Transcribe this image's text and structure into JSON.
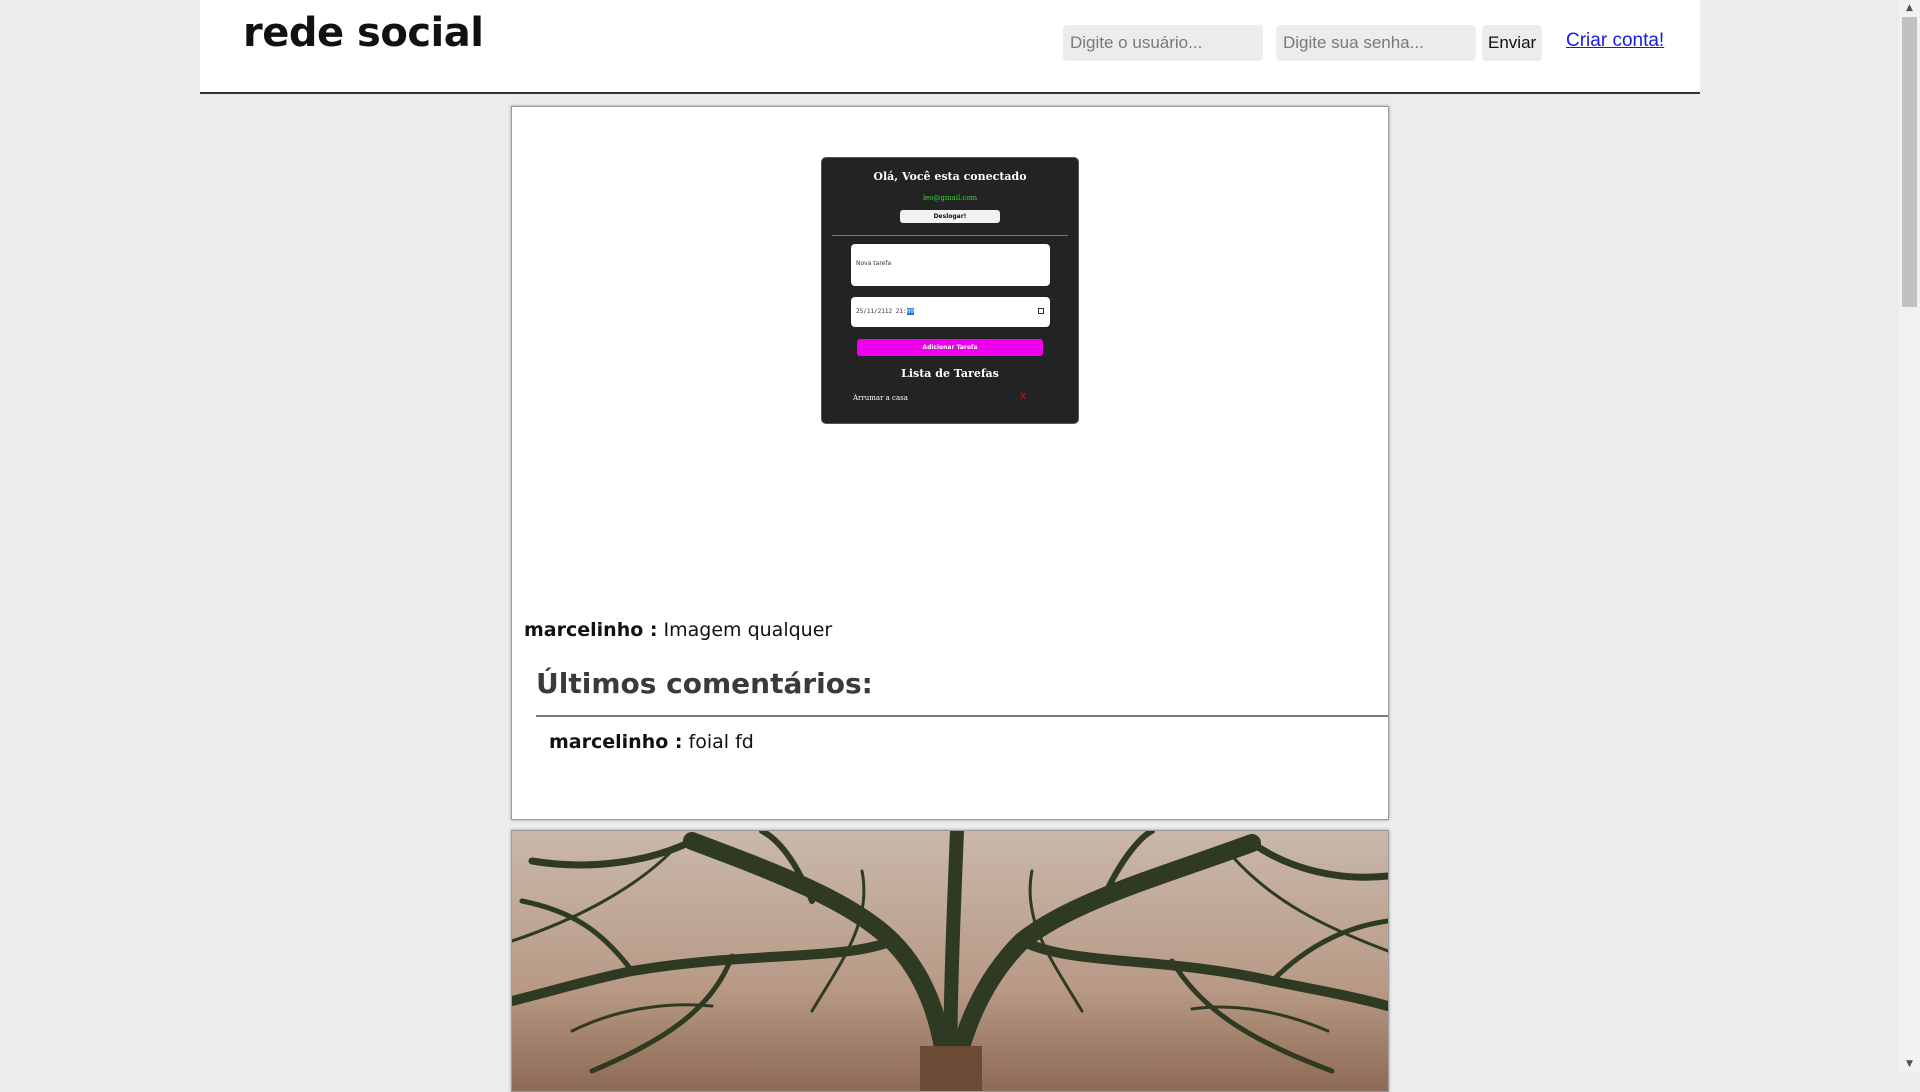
{
  "header": {
    "title": "rede social",
    "username_placeholder": "Digite o usuário...",
    "password_placeholder": "Digite sua senha...",
    "send_label": "Enviar",
    "create_account_label": "Criar conta!"
  },
  "posts": [
    {
      "screenshot": {
        "title": "Olá, Você esta conectado",
        "email": "leo@gmail.com",
        "logout_label": "Deslogar!",
        "task_placeholder": "Nova tarefa",
        "date_value": "25/11/2112",
        "time_hour": "21:",
        "time_minute": "00",
        "add_label": "Adicionar Tarefa",
        "list_title": "Lista de Tarefas",
        "task_item": "Arrumar a casa",
        "remove_label": "X"
      },
      "author": "marcelinho :",
      "caption": "Imagem qualquer",
      "comments_heading": "Últimos comentários:",
      "comments": [
        {
          "author": "marcelinho :",
          "text": "foial fd"
        }
      ]
    },
    {
      "image": "tree-branches-photo"
    }
  ],
  "colors": {
    "page_background": "#ececec",
    "link": "#1a1ae6",
    "accent_button": "#ee00ee",
    "email_green": "#2bdc2b",
    "remove_red": "#e01010"
  }
}
